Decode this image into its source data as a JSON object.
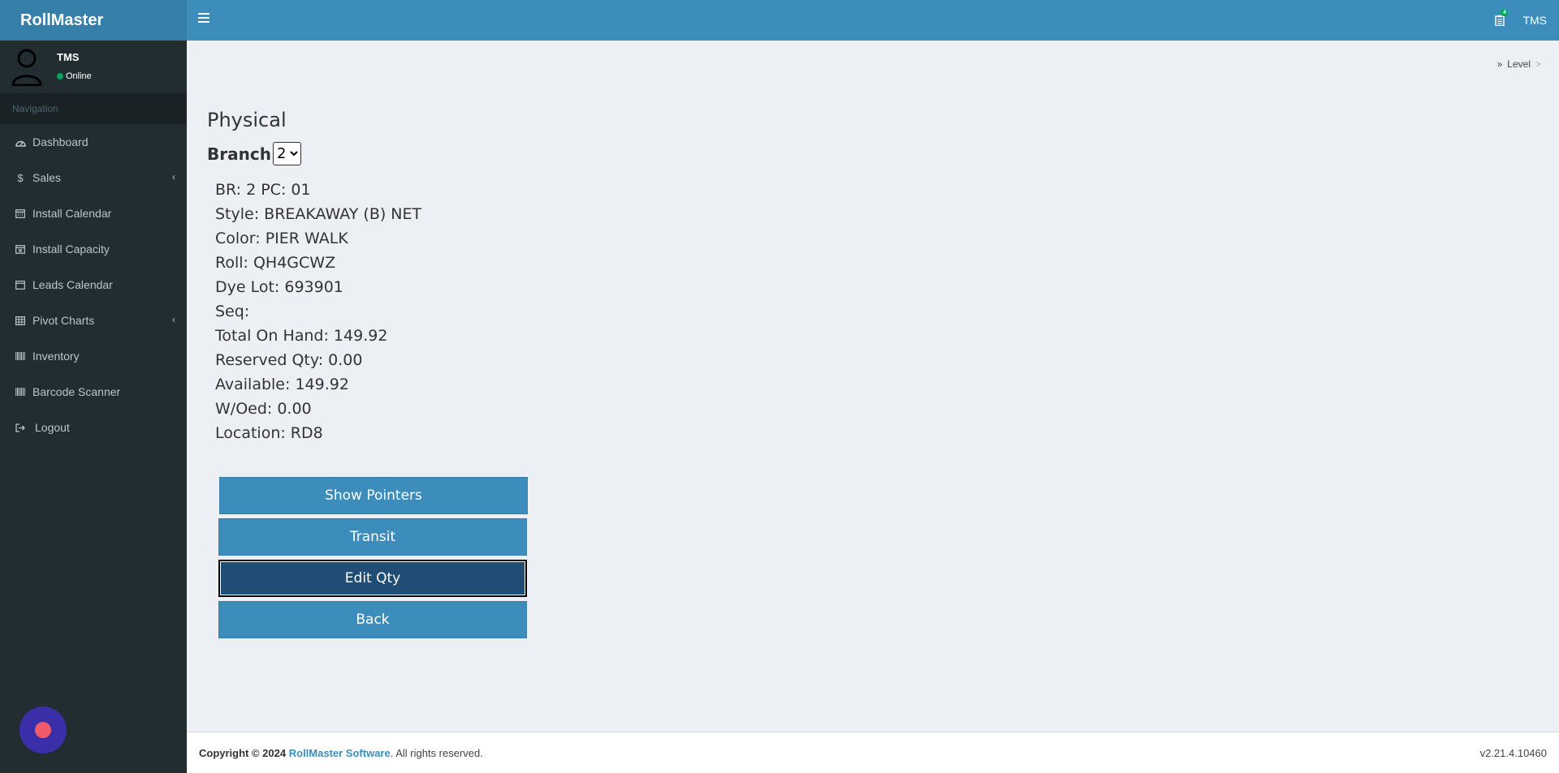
{
  "app": {
    "logo": "RollMaster"
  },
  "topbar": {
    "notif_count": "4",
    "user": "TMS"
  },
  "user_panel": {
    "name": "TMS",
    "status": "Online"
  },
  "sidebar": {
    "header": "Navigation",
    "items": [
      {
        "label": "Dashboard",
        "icon": "dashboard-icon"
      },
      {
        "label": "Sales",
        "icon": "dollar-icon"
      },
      {
        "label": "Install Calendar",
        "icon": "calendar-icon"
      },
      {
        "label": "Install Capacity",
        "icon": "calendar-x-icon"
      },
      {
        "label": "Leads Calendar",
        "icon": "calendar-empty-icon"
      },
      {
        "label": "Pivot Charts",
        "icon": "table-icon"
      },
      {
        "label": "Inventory",
        "icon": "barcode-icon"
      },
      {
        "label": "Barcode Scanner",
        "icon": "barcode-icon"
      },
      {
        "label": "Logout",
        "icon": "sign-out-icon"
      }
    ]
  },
  "breadcrumb": {
    "item": "Level",
    "sep": ">"
  },
  "page": {
    "title": "Physical",
    "branch_label": "Branch",
    "branch_value": "2"
  },
  "details": [
    "BR: 2 PC: 01",
    "Style: BREAKAWAY (B) NET",
    "Color: PIER WALK",
    "Roll: QH4GCWZ",
    "Dye Lot: 693901",
    "Seq:",
    "Total On Hand: 149.92",
    "Reserved Qty: 0.00",
    "Available: 149.92",
    "W/Oed: 0.00",
    "Location: RD8"
  ],
  "buttons": {
    "show_pointers": "Show Pointers",
    "transit": "Transit",
    "edit_qty": "Edit Qty",
    "back": "Back"
  },
  "footer": {
    "copyright": "Copyright © 2024",
    "company": "RollMaster Software",
    "rights": ". All rights reserved.",
    "version": "v2.21.4.10460"
  },
  "colors": {
    "header": "#3c8dbc",
    "logo_bg": "#367fa9",
    "sidebar": "#222d32",
    "content_bg": "#ecf0f5",
    "button": "#3c8dbc",
    "button_active": "#204d74"
  }
}
